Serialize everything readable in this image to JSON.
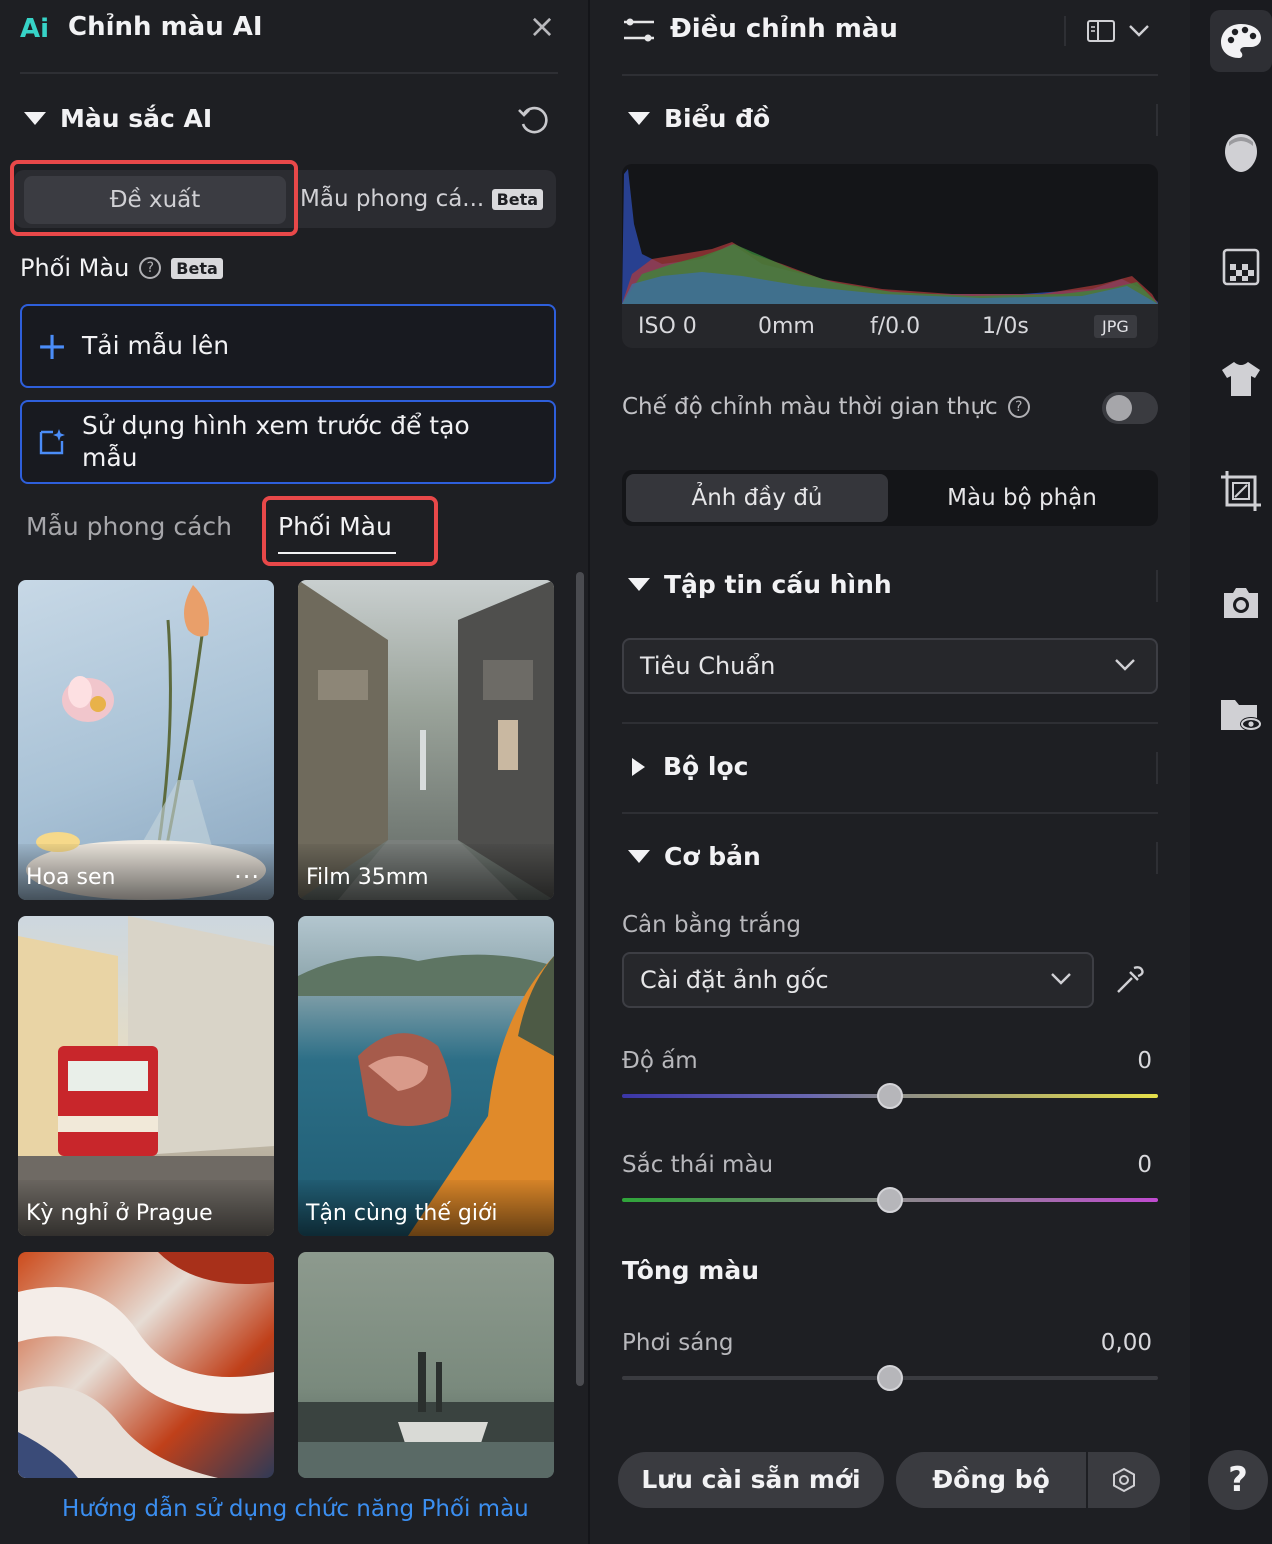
{
  "left_panel": {
    "logo_text": "Ai",
    "title": "Chỉnh màu AI",
    "section_title": "Màu sắc AI",
    "segment": {
      "active": "Đề xuất",
      "second": "Mẫu phong cá...",
      "second_badge": "Beta"
    },
    "phoi_mau": {
      "title": "Phối Màu",
      "help": "?",
      "badge": "Beta"
    },
    "upload_label": "Tải mẫu lên",
    "preview_label": "Sử dụng hình xem trước để tạo mẫu",
    "tabs": {
      "style": "Mẫu phong cách",
      "color": "Phối Màu"
    },
    "cards": [
      "Hoa sen",
      "Film 35mm",
      "Kỳ nghỉ ở Prague",
      "Tận cùng thế giới",
      "",
      ""
    ],
    "card_more": "···",
    "guide_link": "Hướng dẫn sử dụng chức năng Phối màu"
  },
  "right_panel": {
    "title": "Điều chỉnh màu",
    "histogram": {
      "title": "Biểu đồ",
      "iso": "ISO 0",
      "focal": "0mm",
      "aperture": "f/0.0",
      "shutter": "1/0s",
      "format": "JPG"
    },
    "realtime_label": "Chế độ chỉnh màu thời gian thực",
    "realtime_on": false,
    "view_tabs": {
      "full": "Ảnh đầy đủ",
      "partial": "Màu bộ phận"
    },
    "profile": {
      "title": "Tập tin cấu hình",
      "value": "Tiêu Chuẩn"
    },
    "filter_title": "Bộ lọc",
    "basic": {
      "title": "Cơ bản",
      "wb_label": "Cân bằng trắng",
      "wb_value": "Cài đặt ảnh gốc",
      "warmth_label": "Độ ấm",
      "warmth_value": "0",
      "tint_label": "Sắc thái màu",
      "tint_value": "0",
      "tone_title": "Tông màu",
      "exposure_label": "Phơi sáng",
      "exposure_value": "0,00"
    },
    "buttons": {
      "save_preset": "Lưu cài sẵn mới",
      "sync": "Đồng bộ"
    }
  },
  "rail": {
    "icons": [
      "palette-icon",
      "face-icon",
      "mosaic-icon",
      "shirt-icon",
      "crop-icon",
      "camera-icon",
      "folder-eye-icon"
    ],
    "help": "?"
  },
  "colors": {
    "accent_blue": "#2e5fdb",
    "highlight_red": "#e84849",
    "link_blue": "#3b8ef0"
  }
}
